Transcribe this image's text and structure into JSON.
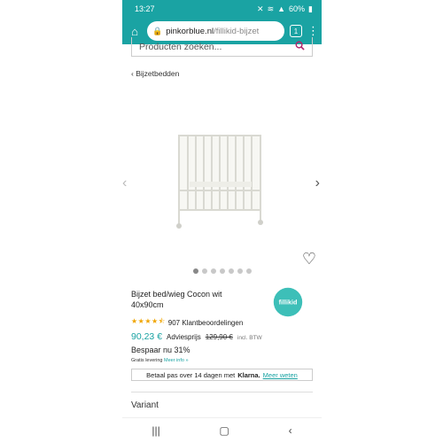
{
  "status": {
    "time": "13:27",
    "battery": "60%"
  },
  "browser": {
    "url_host": "pinkorblue.nl",
    "url_path": "/fillikid-bijzet",
    "tab_count": "1"
  },
  "search": {
    "placeholder": "Producten zoeken..."
  },
  "breadcrumb": {
    "label": "Bijzetbedden"
  },
  "gallery": {
    "dot_count": 7,
    "active_index": 0
  },
  "product": {
    "title": "Bijzet bed/wieg Cocon wit 40x90cm",
    "brand": "fillikid",
    "rating": 4.5,
    "reviews": "907 Klantbeoordelingen",
    "price": "90,23 €",
    "advice_label": "Adviesprijs",
    "old_price": "129,90 €",
    "btw": "incl. BTW",
    "saving": "Bespaar nu 31%",
    "delivery": "Gratis levering",
    "delivery_more": "Meer info »"
  },
  "klarna": {
    "text": "Betaal pas over 14 dagen met",
    "brand": "Klarna.",
    "link": "Meer weten"
  },
  "variant": {
    "label": "Variant"
  },
  "colors": {
    "teal": "#1aa3a3",
    "star": "#f0a500",
    "brand_bg": "#3dbfb8",
    "search_icon": "#b3236b"
  }
}
